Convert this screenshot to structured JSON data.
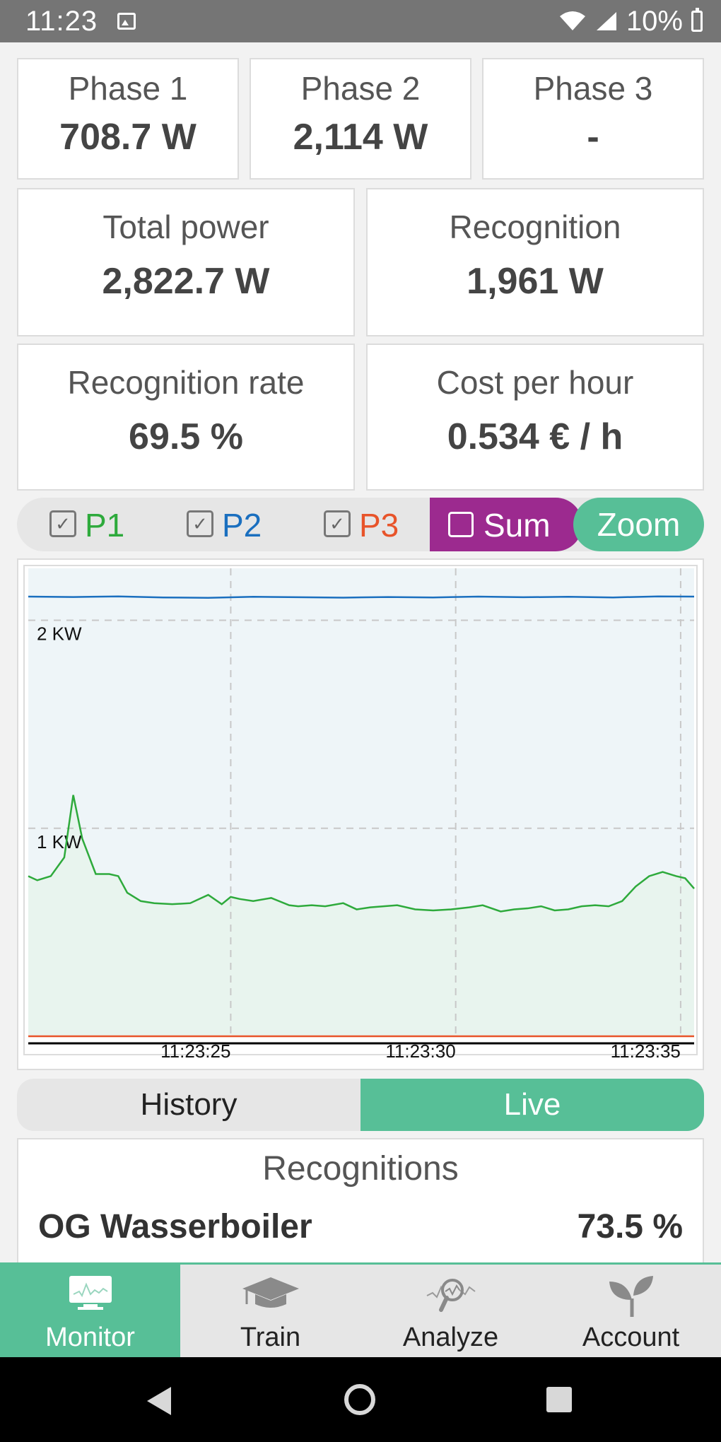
{
  "status": {
    "time": "11:23",
    "battery": "10%"
  },
  "phases": [
    {
      "label": "Phase 1",
      "value": "708.7 W"
    },
    {
      "label": "Phase 2",
      "value": "2,114 W"
    },
    {
      "label": "Phase 3",
      "value": "-"
    }
  ],
  "stats": {
    "total_power": {
      "label": "Total power",
      "value": "2,822.7 W"
    },
    "recognition": {
      "label": "Recognition",
      "value": "1,961 W"
    },
    "recognition_rate": {
      "label": "Recognition rate",
      "value": "69.5 %"
    },
    "cost_per_hour": {
      "label": "Cost per hour",
      "value": "0.534 € / h"
    }
  },
  "toggles": {
    "p1": {
      "label": "P1",
      "checked": true,
      "color": "#2eaa3c"
    },
    "p2": {
      "label": "P2",
      "checked": true,
      "color": "#1a6fbf"
    },
    "p3": {
      "label": "P3",
      "checked": true,
      "color": "#e8542a"
    },
    "sum": {
      "label": "Sum",
      "checked": false,
      "color": "#9c2a8f"
    },
    "zoom": {
      "label": "Zoom"
    }
  },
  "chart_data": {
    "type": "line",
    "y_tick_labels": [
      "2 KW",
      "1 KW"
    ],
    "y_ticks": [
      2000,
      1000
    ],
    "ylim": [
      0,
      2250
    ],
    "x_tick_labels": [
      "11:23:25",
      "11:23:30",
      "11:23:35"
    ],
    "x_ticks": [
      4.5,
      9.5,
      14.5
    ],
    "xlim": [
      0,
      14.8
    ],
    "grid": true,
    "series": [
      {
        "name": "P1",
        "color": "#2eaa3c",
        "x": [
          0,
          0.2,
          0.5,
          0.8,
          1.0,
          1.2,
          1.5,
          1.8,
          2.0,
          2.2,
          2.5,
          2.8,
          3.2,
          3.6,
          4.0,
          4.3,
          4.5,
          4.7,
          5.0,
          5.4,
          5.8,
          6.0,
          6.3,
          6.6,
          7.0,
          7.3,
          7.6,
          7.9,
          8.2,
          8.6,
          9.0,
          9.4,
          9.8,
          10.1,
          10.5,
          10.8,
          11.1,
          11.4,
          11.7,
          12.0,
          12.3,
          12.6,
          12.9,
          13.2,
          13.5,
          13.8,
          14.1,
          14.4,
          14.6,
          14.8
        ],
        "y": [
          770,
          750,
          770,
          860,
          1160,
          950,
          780,
          780,
          770,
          690,
          650,
          640,
          635,
          640,
          680,
          635,
          670,
          660,
          650,
          665,
          630,
          625,
          630,
          625,
          640,
          610,
          620,
          625,
          630,
          610,
          605,
          610,
          620,
          630,
          600,
          610,
          615,
          625,
          605,
          610,
          625,
          630,
          625,
          650,
          720,
          770,
          790,
          770,
          760,
          710
        ]
      },
      {
        "name": "P2",
        "color": "#1a6fbf",
        "x": [
          0,
          1,
          2,
          3,
          4,
          5,
          6,
          7,
          8,
          9,
          10,
          11,
          12,
          13,
          14,
          14.8
        ],
        "y": [
          2114,
          2112,
          2115,
          2110,
          2108,
          2113,
          2111,
          2109,
          2112,
          2110,
          2114,
          2111,
          2113,
          2110,
          2115,
          2114
        ]
      },
      {
        "name": "P3",
        "color": "#e8542a",
        "x": [
          0,
          14.8
        ],
        "y": [
          0,
          0
        ]
      }
    ]
  },
  "mode": {
    "history": "History",
    "live": "Live"
  },
  "recognitions": {
    "title": "Recognitions",
    "items": [
      {
        "name": "OG Wasserboiler",
        "value": "73.5 %"
      }
    ]
  },
  "nav": [
    {
      "label": "Monitor",
      "active": true
    },
    {
      "label": "Train",
      "active": false
    },
    {
      "label": "Analyze",
      "active": false
    },
    {
      "label": "Account",
      "active": false
    }
  ]
}
